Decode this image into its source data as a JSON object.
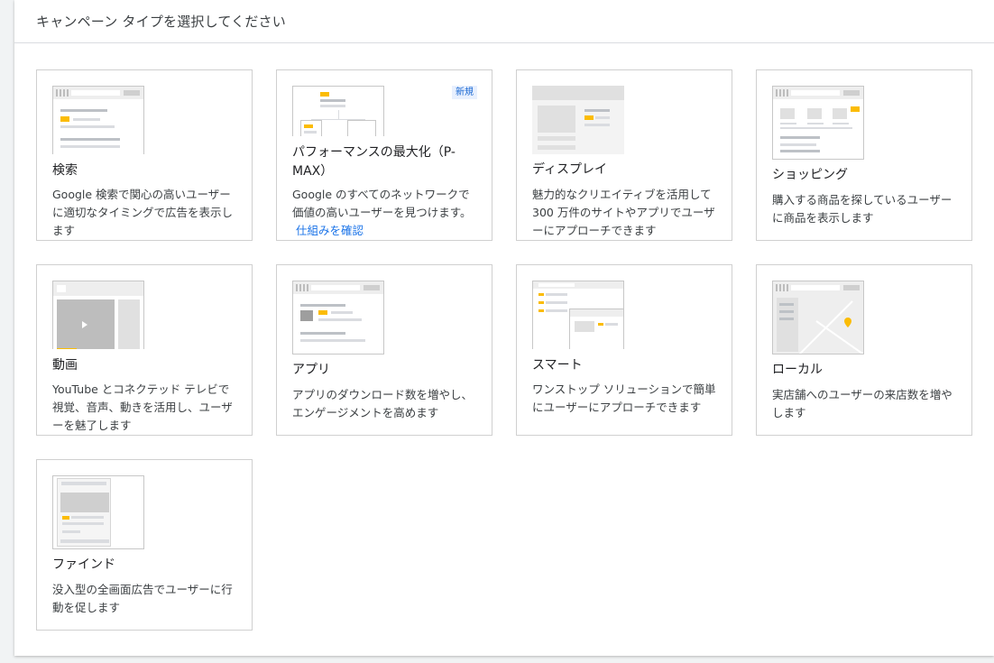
{
  "header": {
    "title": "キャンペーン タイプを選択してください"
  },
  "cards": [
    {
      "title": "検索",
      "description": "Google 検索で関心の高いユーザーに適切なタイミングで広告を表示します"
    },
    {
      "title": "パフォーマンスの最大化（P-MAX）",
      "description": "Google のすべてのネットワークで価値の高いユーザーを見つけます。",
      "link": "仕組みを確認",
      "badge": "新規"
    },
    {
      "title": "ディスプレイ",
      "description": "魅力的なクリエイティブを活用して 300 万件のサイトやアプリでユーザーにアプローチできます"
    },
    {
      "title": "ショッピング",
      "description": "購入する商品を探しているユーザーに商品を表示します"
    },
    {
      "title": "動画",
      "description": "YouTube とコネクテッド テレビで視覚、音声、動きを活用し、ユーザーを魅了します"
    },
    {
      "title": "アプリ",
      "description": "アプリのダウンロード数を増やし、エンゲージメントを高めます"
    },
    {
      "title": "スマート",
      "description": "ワンストップ ソリューションで簡単にユーザーにアプローチできます"
    },
    {
      "title": "ローカル",
      "description": "実店舗へのユーザーの来店数を増やします"
    },
    {
      "title": "ファインド",
      "description": "没入型の全画面広告でユーザーに行動を促します"
    }
  ],
  "colors": {
    "accent": "#fbbc04",
    "link": "#1a73e8",
    "border": "#d0d0d0"
  }
}
